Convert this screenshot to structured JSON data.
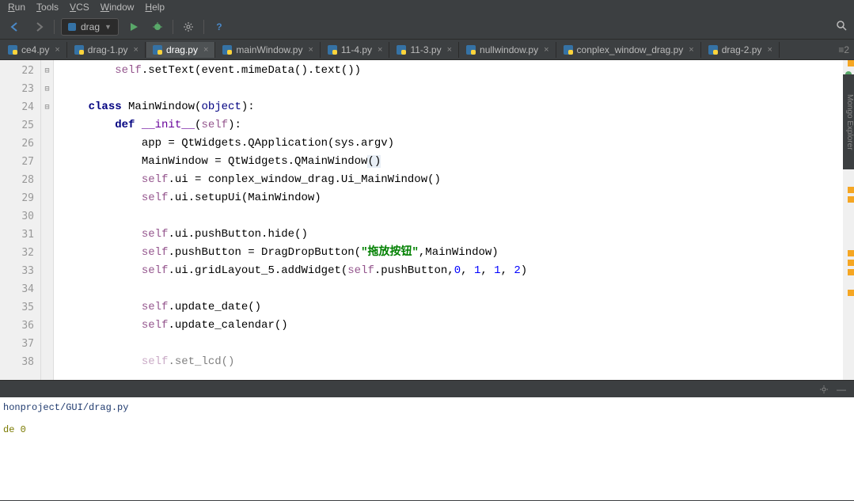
{
  "menu": {
    "items": [
      "Run",
      "Tools",
      "VCS",
      "Window",
      "Help"
    ]
  },
  "toolbar": {
    "run_config": "drag",
    "nav_back_label": "Back",
    "nav_fwd_label": "Forward"
  },
  "tabs": {
    "items": [
      {
        "label": "ce4.py"
      },
      {
        "label": "drag-1.py"
      },
      {
        "label": "drag.py",
        "active": true
      },
      {
        "label": "mainWindow.py"
      },
      {
        "label": "11-4.py"
      },
      {
        "label": "11-3.py"
      },
      {
        "label": "nullwindow.py"
      },
      {
        "label": "conplex_window_drag.py"
      },
      {
        "label": "drag-2.py"
      }
    ],
    "overflow_badge": "≡2"
  },
  "editor": {
    "line_start": 22,
    "lines": [
      {
        "n": 22,
        "indent": 2,
        "tokens": [
          {
            "t": "self",
            "c": "self"
          },
          {
            "t": "",
            "c": ".setText(event.mimeData().text())"
          }
        ]
      },
      {
        "n": 23,
        "indent": 0,
        "tokens": []
      },
      {
        "n": 24,
        "indent": 1,
        "tokens": [
          {
            "t": "kw",
            "c": "class "
          },
          {
            "t": "",
            "c": "MainWindow("
          },
          {
            "t": "builtin",
            "c": "object"
          },
          {
            "t": "",
            "c": "):"
          }
        ]
      },
      {
        "n": 25,
        "indent": 2,
        "tokens": [
          {
            "t": "kw",
            "c": "def "
          },
          {
            "t": "fn",
            "c": "__init__"
          },
          {
            "t": "",
            "c": "("
          },
          {
            "t": "self",
            "c": "self"
          },
          {
            "t": "",
            "c": "):"
          }
        ]
      },
      {
        "n": 26,
        "indent": 3,
        "tokens": [
          {
            "t": "",
            "c": "app = QtWidgets.QApplication(sys.argv)"
          }
        ]
      },
      {
        "n": 27,
        "indent": 3,
        "tokens": [
          {
            "t": "",
            "c": "MainWindow = QtWidgets.QMainWindow"
          },
          {
            "t": "hl",
            "c": "()"
          }
        ]
      },
      {
        "n": 28,
        "indent": 3,
        "tokens": [
          {
            "t": "self",
            "c": "self"
          },
          {
            "t": "",
            "c": ".ui = conplex_window_drag.Ui_MainWindow()"
          }
        ]
      },
      {
        "n": 29,
        "indent": 3,
        "tokens": [
          {
            "t": "self",
            "c": "self"
          },
          {
            "t": "",
            "c": ".ui.setupUi(MainWindow)"
          }
        ]
      },
      {
        "n": 30,
        "indent": 0,
        "tokens": []
      },
      {
        "n": 31,
        "indent": 3,
        "tokens": [
          {
            "t": "self",
            "c": "self"
          },
          {
            "t": "",
            "c": ".ui.pushButton.hide()"
          }
        ]
      },
      {
        "n": 32,
        "indent": 3,
        "tokens": [
          {
            "t": "self",
            "c": "self"
          },
          {
            "t": "",
            "c": ".pushButton = DragDropButton("
          },
          {
            "t": "str",
            "c": "\"拖放按钮\""
          },
          {
            "t": "",
            "c": ",MainWindow)"
          }
        ]
      },
      {
        "n": 33,
        "indent": 3,
        "tokens": [
          {
            "t": "self",
            "c": "self"
          },
          {
            "t": "",
            "c": ".ui.gridLayout_5.addWidget("
          },
          {
            "t": "self",
            "c": "self"
          },
          {
            "t": "",
            "c": ".pushButton,"
          },
          {
            "t": "num",
            "c": "0"
          },
          {
            "t": "",
            "c": ", "
          },
          {
            "t": "num",
            "c": "1"
          },
          {
            "t": "",
            "c": ", "
          },
          {
            "t": "num",
            "c": "1"
          },
          {
            "t": "",
            "c": ", "
          },
          {
            "t": "num",
            "c": "2"
          },
          {
            "t": "",
            "c": ")"
          }
        ]
      },
      {
        "n": 34,
        "indent": 0,
        "tokens": []
      },
      {
        "n": 35,
        "indent": 3,
        "tokens": [
          {
            "t": "self",
            "c": "self"
          },
          {
            "t": "",
            "c": ".update_date()"
          }
        ]
      },
      {
        "n": 36,
        "indent": 3,
        "tokens": [
          {
            "t": "self",
            "c": "self"
          },
          {
            "t": "",
            "c": ".update_calendar()"
          }
        ]
      },
      {
        "n": 37,
        "indent": 0,
        "tokens": []
      },
      {
        "n": 38,
        "indent": 3,
        "tokens": [
          {
            "t": "self",
            "c": "self"
          },
          {
            "t": "",
            "c": ".set_lcd()"
          }
        ],
        "cut": true
      }
    ]
  },
  "console": {
    "path": "honproject/GUI/drag.py",
    "exit": "de 0"
  },
  "side_tool_label": "Mongo Explorer"
}
